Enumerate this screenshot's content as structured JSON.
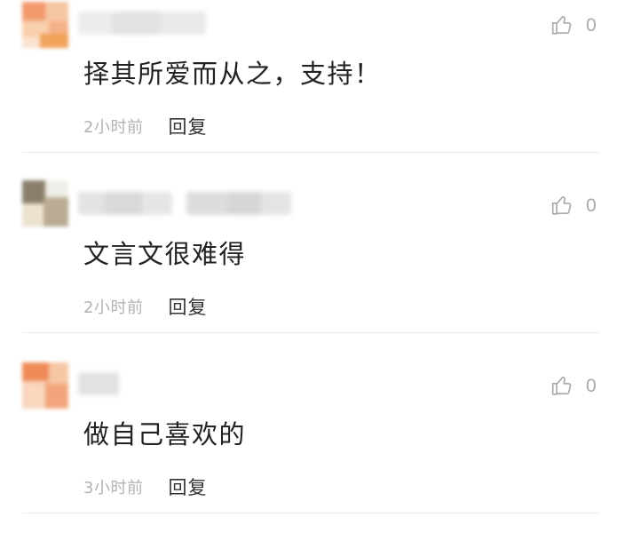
{
  "comments": [
    {
      "text": "择其所爱而从之，支持！",
      "time": "2小时前",
      "reply_label": "回复",
      "likes": "0"
    },
    {
      "text": "文言文很难得",
      "time": "2小时前",
      "reply_label": "回复",
      "likes": "0"
    },
    {
      "text": "做自己喜欢的",
      "time": "3小时前",
      "reply_label": "回复",
      "likes": "0"
    }
  ],
  "icons": {
    "like": "thumbs-up-icon"
  },
  "colors": {
    "secondary_text": "#b3b3b3",
    "like_icon": "#a9a9a9",
    "divider": "#ececec"
  }
}
